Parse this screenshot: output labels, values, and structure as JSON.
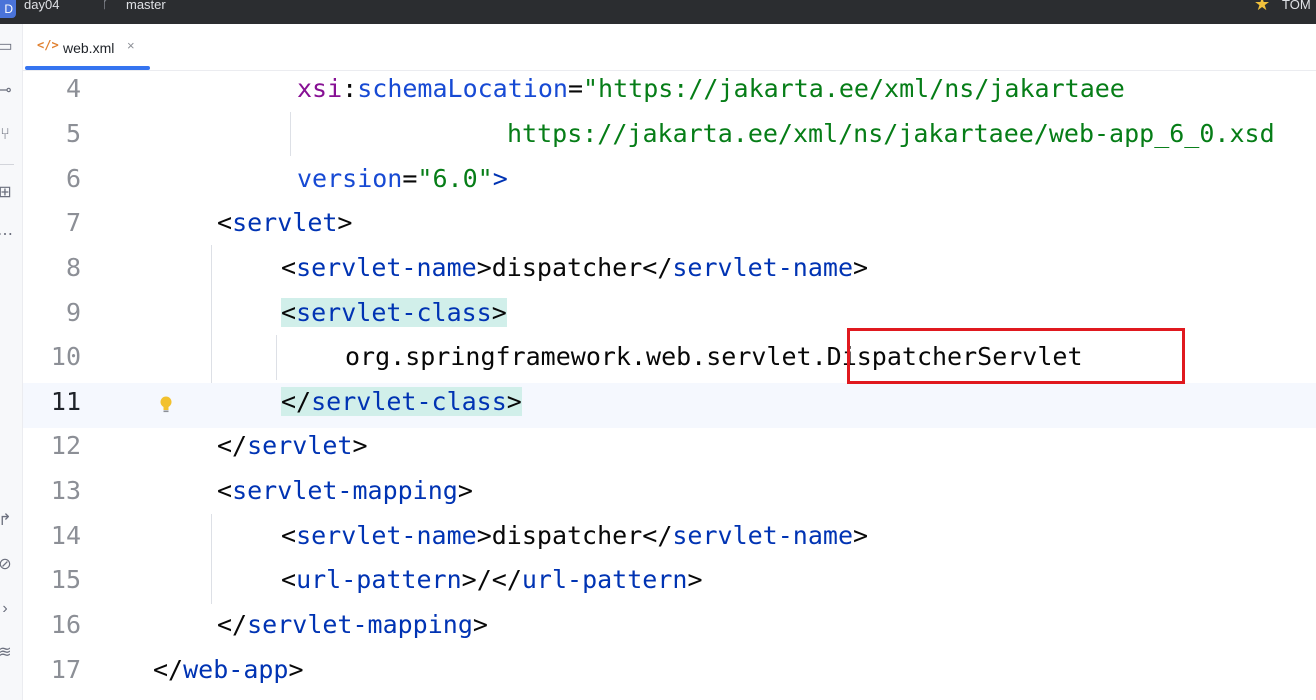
{
  "titlebar": {
    "project_badge": "D",
    "project_name": "day04",
    "branch_icon": "branch-icon",
    "branch_name": "master",
    "run_config_name": "TOM"
  },
  "sidebar": {
    "icons": [
      "folder-icon",
      "commit-icon",
      "pull-request-icon",
      "structure-icon",
      "more-icon",
      "run-icon",
      "services-icon",
      "terminal-icon",
      "layers-icon"
    ]
  },
  "tab": {
    "icon": "xml-file-icon",
    "icon_glyph": "</>",
    "label": "web.xml",
    "close": "×"
  },
  "editor": {
    "current_line": 11,
    "highlight_color": "#d1efea",
    "lines": [
      {
        "num": "4",
        "parts": [
          "xsi",
          ":",
          "schemaLocation",
          "=",
          "\"https://jakarta.ee/xml/ns/jakartaee"
        ]
      },
      {
        "num": "5",
        "parts": [
          "https://jakarta.ee/xml/ns/jakartaee/web-app_6_0.xsd"
        ]
      },
      {
        "num": "6",
        "parts": [
          "version",
          "=",
          "\"6.0\"",
          ">"
        ]
      },
      {
        "num": "7",
        "parts": [
          "<",
          "servlet",
          ">"
        ]
      },
      {
        "num": "8",
        "parts": [
          "<",
          "servlet-name",
          ">",
          "dispatcher",
          "</",
          "servlet-name",
          ">"
        ]
      },
      {
        "num": "9",
        "parts": [
          "<",
          "servlet-class",
          ">"
        ]
      },
      {
        "num": "10",
        "parts": [
          "org.springframework.web.servlet.",
          "DispatcherServlet"
        ]
      },
      {
        "num": "11",
        "parts": [
          "</",
          "servlet-class",
          ">"
        ]
      },
      {
        "num": "12",
        "parts": [
          "</",
          "servlet",
          ">"
        ]
      },
      {
        "num": "13",
        "parts": [
          "<",
          "servlet-mapping",
          ">"
        ]
      },
      {
        "num": "14",
        "parts": [
          "<",
          "servlet-name",
          ">",
          "dispatcher",
          "</",
          "servlet-name",
          ">"
        ]
      },
      {
        "num": "15",
        "parts": [
          "<",
          "url-pattern",
          ">",
          "/",
          "</",
          "url-pattern",
          ">"
        ]
      },
      {
        "num": "16",
        "parts": [
          "</",
          "servlet-mapping",
          ">"
        ]
      },
      {
        "num": "17",
        "parts": [
          "</",
          "web-app",
          ">"
        ]
      }
    ]
  },
  "annotation": {
    "color": "#e0191f",
    "highlighted_text": "DispatcherServlet"
  },
  "colors": {
    "tag": "#0033b3",
    "namespace": "#871094",
    "attribute": "#174ad4",
    "string": "#067d17",
    "text": "#080808",
    "accent": "#3574f0"
  }
}
